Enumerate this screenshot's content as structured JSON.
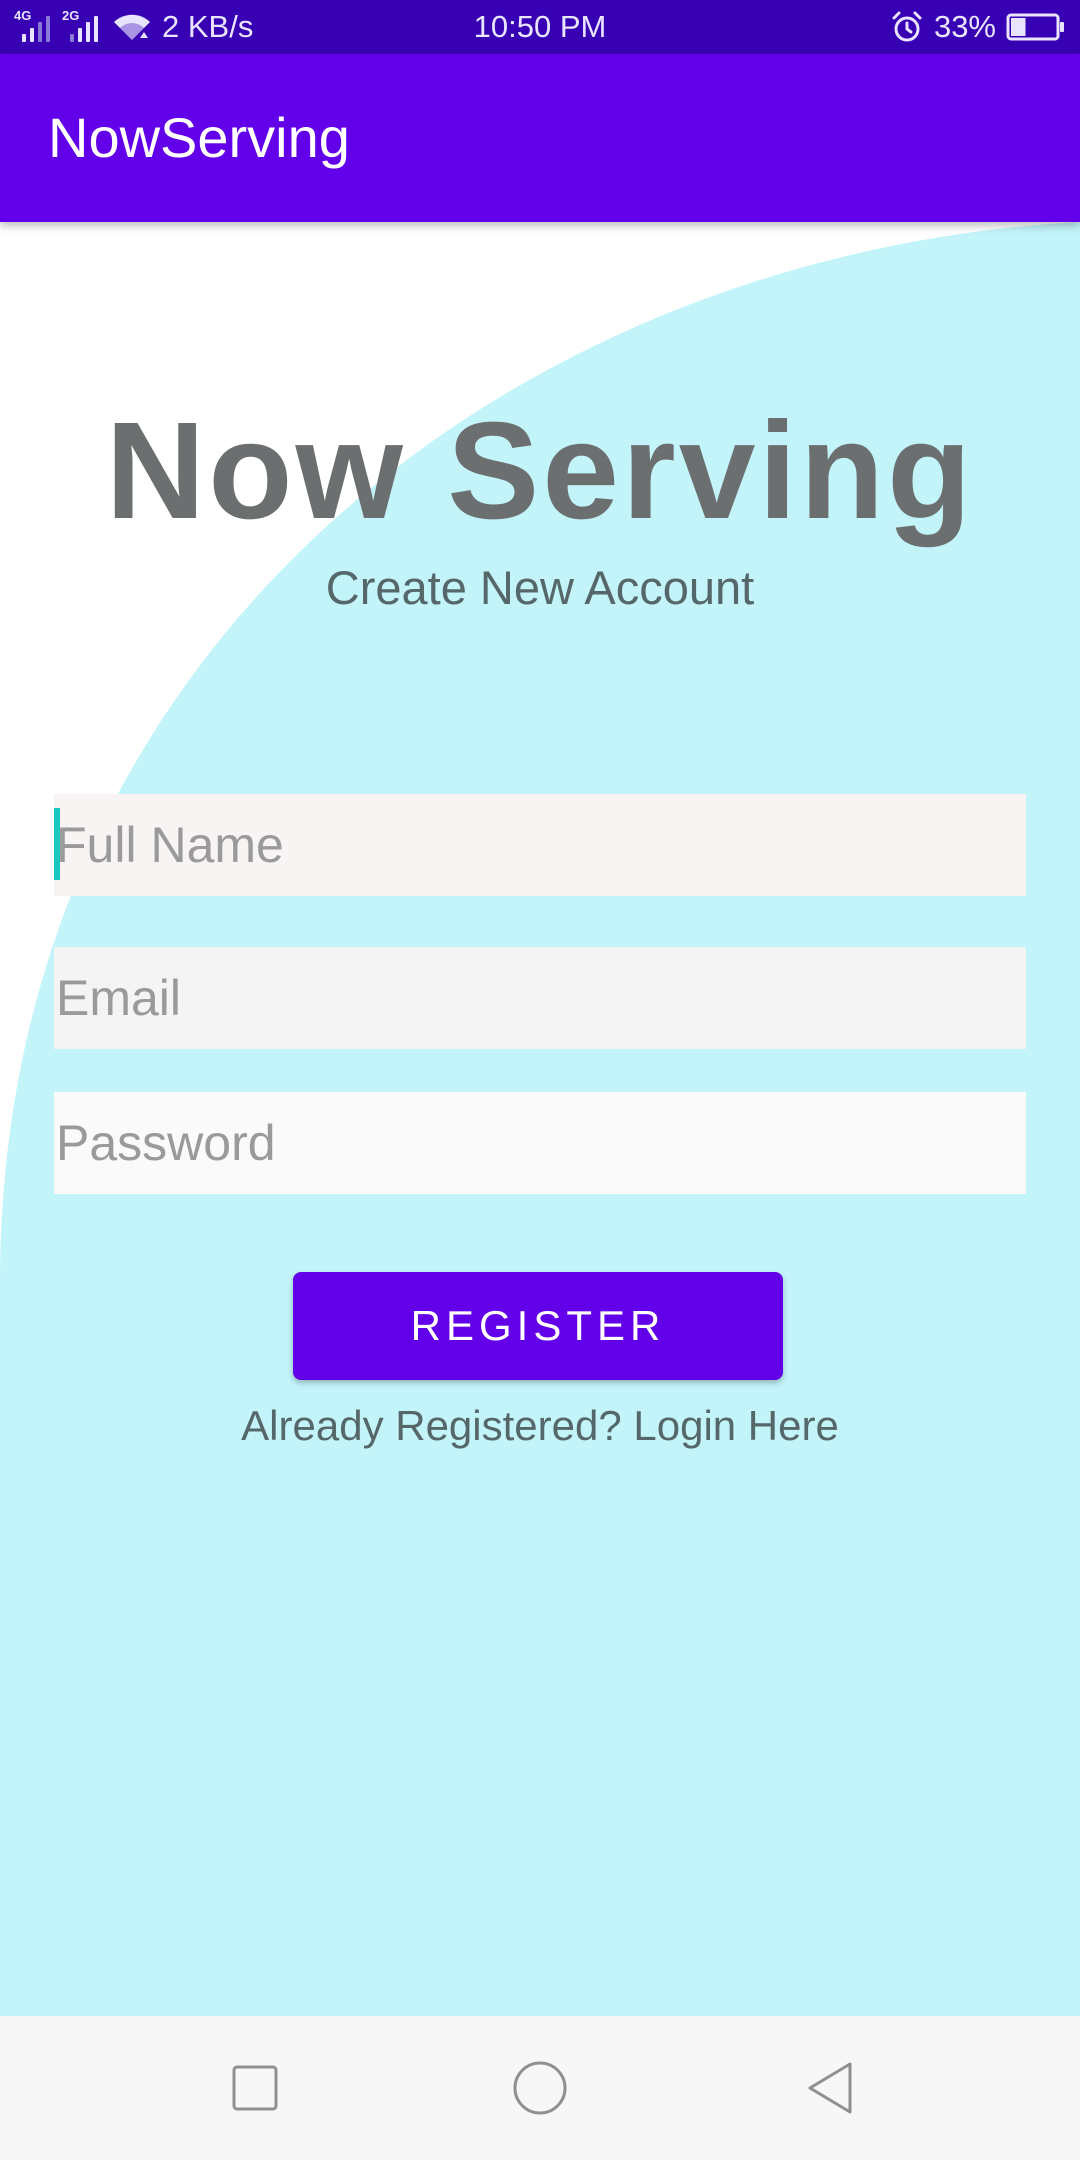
{
  "status_bar": {
    "network_1": "4G",
    "network_2": "2G",
    "speed": "2 KB/s",
    "time": "10:50 PM",
    "battery": "33%",
    "battery_level": 0.33
  },
  "app_bar": {
    "title": "NowServing"
  },
  "hero": {
    "title": "Now Serving",
    "subtitle": "Create New Account"
  },
  "form": {
    "full_name_placeholder": "Full Name",
    "email_placeholder": "Email",
    "password_placeholder": "Password",
    "register_label": "REGISTER",
    "login_link": "Already Registered? Login Here"
  },
  "colors": {
    "status_bar": "#3700b3",
    "primary": "#6200ea",
    "background_curve": "#c2f4fa",
    "caret": "#1bc8c0"
  },
  "nav_bar": {
    "icons": [
      "recents-square-icon",
      "home-circle-icon",
      "back-triangle-icon"
    ]
  }
}
